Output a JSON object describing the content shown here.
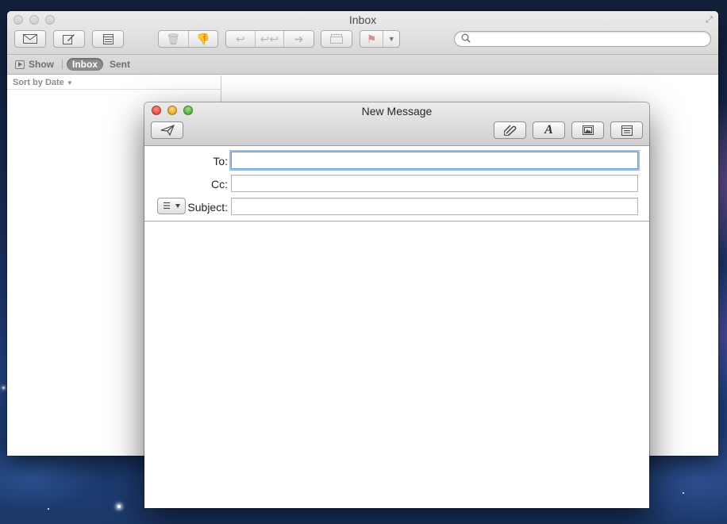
{
  "main_window": {
    "title": "Inbox",
    "toolbar_icons": [
      "get-mail-icon",
      "compose-icon",
      "note-icon",
      "trash-icon",
      "junk-icon",
      "reply-icon",
      "reply-all-icon",
      "forward-icon",
      "archive-icon",
      "flag-icon",
      "search-icon"
    ],
    "search_placeholder": ""
  },
  "favorites_bar": {
    "show_label": "Show",
    "mailboxes": [
      "Inbox",
      "Sent"
    ],
    "selected": "Inbox"
  },
  "message_list": {
    "sort_label": "Sort by Date"
  },
  "compose": {
    "title": "New Message",
    "fields": {
      "to_label": "To:",
      "to_value": "",
      "cc_label": "Cc:",
      "cc_value": "",
      "subject_label": "Subject:",
      "subject_value": ""
    },
    "header_menu_glyph": "☰",
    "toolbar_icons": [
      "send-icon",
      "attach-icon",
      "format-icon",
      "photo-browser-icon",
      "template-icon"
    ],
    "colors": {
      "close": "#e0443e",
      "minimize": "#dea123",
      "maximize": "#4aab35",
      "focus_ring": "#9cc1ec"
    }
  }
}
